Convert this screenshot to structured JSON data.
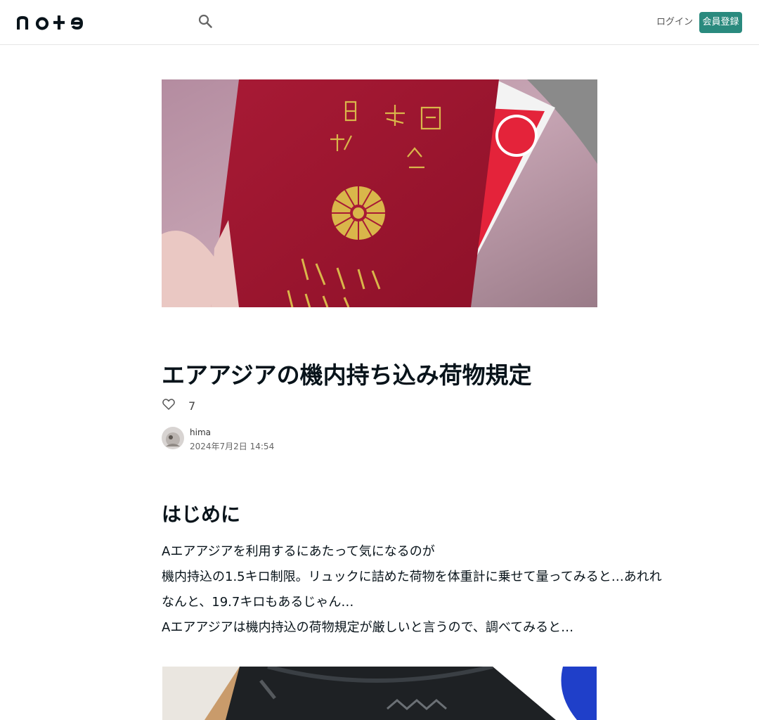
{
  "header": {
    "logo": "note",
    "login_label": "ログイン",
    "signup_label": "会員登録"
  },
  "article": {
    "title": "エアアジアの機内持ち込み荷物規定",
    "like_count": "7",
    "author_name": "hima",
    "post_date": "2024年7月2日 14:54",
    "section_heading": "はじめに",
    "paragraphs": [
      "Aエアアジアを利用するにあたって気になるのが",
      "機内持込の1.5キロ制限。リュックに詰めた荷物を体重計に乗せて量ってみると…あれれ",
      "なんと、19.7キロもあるじゃん…",
      "Aエアアジアは機内持込の荷物規定が厳しいと言うので、調べてみると…"
    ]
  },
  "icons": {
    "search": "search-icon",
    "like": "heart-icon"
  },
  "colors": {
    "brand_green": "#2a8a7e",
    "text_primary": "#08131a",
    "passport_red": "#a0152e"
  }
}
